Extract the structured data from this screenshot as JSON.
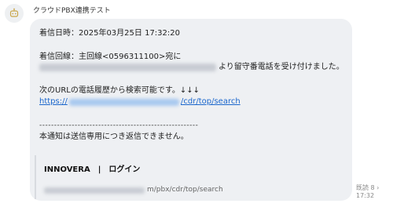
{
  "chat": {
    "sender_name": "クラウドPBX連携テスト",
    "avatar_icon": "bot-face-icon"
  },
  "message": {
    "line_datetime": "着信日時：2025年03月25日 17:32:20",
    "line_callee_prefix": "着信回線：主回線<0596311100>宛に",
    "line_callee_suffix": "より留守番電話を受け付けました。",
    "line_url_intro": "次のURLの電話履歴から検索可能です。↓↓↓",
    "link_prefix": "https://",
    "link_suffix": "/cdr/top/search",
    "divider": "------------------------------------------------------",
    "line_notice": "本通知は送信専用につき返信できません。"
  },
  "link_preview": {
    "title": "INNOVERA　|　ログイン",
    "url_suffix": "m/pbx/cdr/top/search"
  },
  "meta": {
    "read_label": "既読 8 ›",
    "time": "17:32"
  },
  "colors": {
    "bubble": "#eef0f3",
    "link": "#1a66cc"
  }
}
